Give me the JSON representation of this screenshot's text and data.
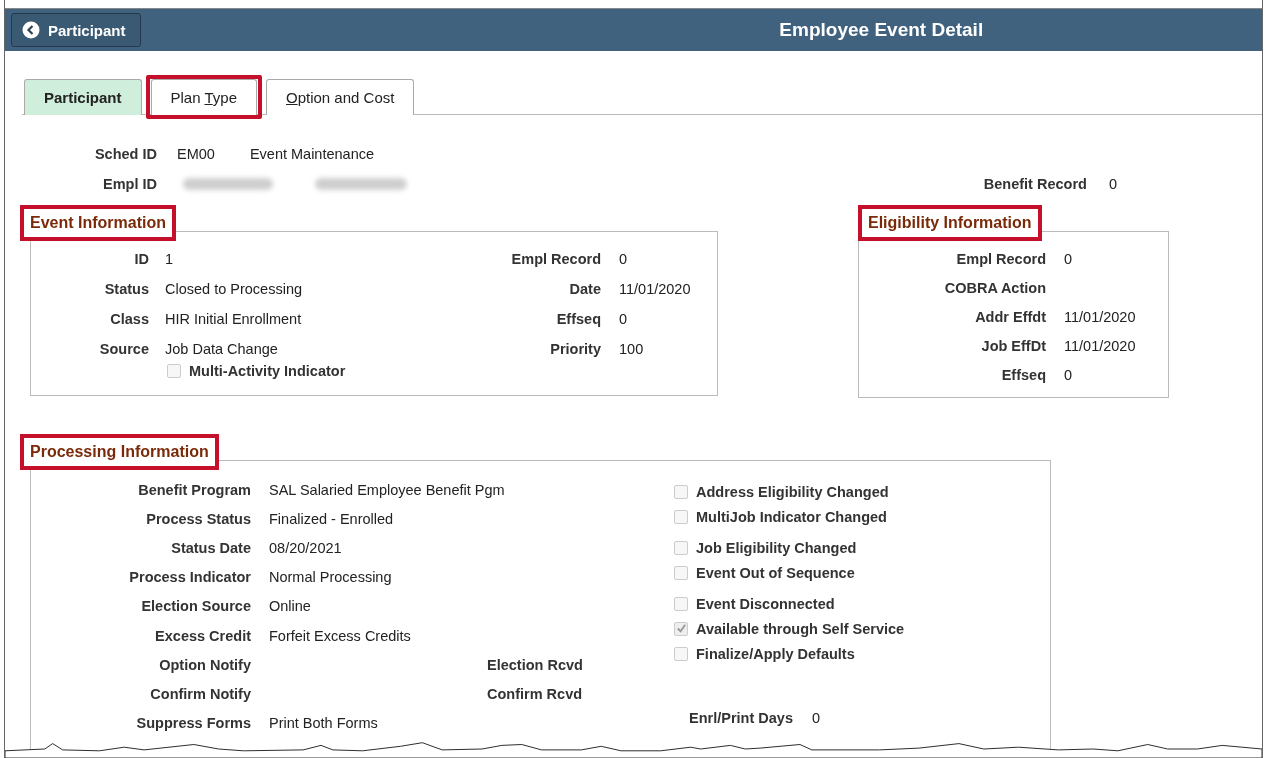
{
  "header": {
    "back_button": {
      "label": "Participant"
    },
    "title": "Employee Event Detail"
  },
  "tabs": [
    {
      "label_parts": [
        {
          "text": "Participant",
          "underlined": false
        }
      ],
      "selected": true,
      "highlighted": false
    },
    {
      "label_parts": [
        {
          "text": "Plan ",
          "underlined": false
        },
        {
          "text": "T",
          "underlined": true
        },
        {
          "text": "ype",
          "underlined": false
        }
      ],
      "selected": false,
      "highlighted": true
    },
    {
      "label_parts": [
        {
          "text": "O",
          "underlined": true
        },
        {
          "text": "ption and Cost",
          "underlined": false
        }
      ],
      "selected": false,
      "highlighted": false
    }
  ],
  "summary": {
    "sched_id": {
      "label": "Sched ID",
      "code": "EM00",
      "description": "Event Maintenance"
    },
    "empl_id": {
      "label": "Empl ID",
      "redacted": true
    },
    "benefit_record": {
      "label": "Benefit Record",
      "value": "0"
    }
  },
  "event_information": {
    "title": "Event Information",
    "highlighted": true,
    "left_fields": [
      {
        "label": "ID",
        "value": "1"
      },
      {
        "label": "Status",
        "value": "Closed to Processing"
      },
      {
        "label": "Class",
        "value": "HIR  Initial Enrollment"
      },
      {
        "label": "Source",
        "value": "Job Data Change"
      }
    ],
    "right_fields": [
      {
        "label": "Empl Record",
        "value": "0"
      },
      {
        "label": "Date",
        "value": "11/01/2020"
      },
      {
        "label": "Effseq",
        "value": "0"
      },
      {
        "label": "Priority",
        "value": "100"
      }
    ],
    "checkbox": {
      "label": "Multi-Activity Indicator",
      "checked": false
    }
  },
  "eligibility_information": {
    "title": "Eligibility Information",
    "highlighted": true,
    "fields": [
      {
        "label": "Empl Record",
        "value": "0"
      },
      {
        "label": "COBRA Action"
      },
      {
        "label": "Addr Effdt",
        "value": "11/01/2020"
      },
      {
        "label": "Job EffDt",
        "value": "11/01/2020"
      },
      {
        "label": "Effseq",
        "value": "0"
      }
    ]
  },
  "processing_information": {
    "title": "Processing Information",
    "highlighted": true,
    "fields": [
      {
        "label": "Benefit Program",
        "value": "SAL  Salaried Employee Benefit Pgm"
      },
      {
        "label": "Process Status",
        "value": "Finalized - Enrolled"
      },
      {
        "label": "Status Date",
        "value": "08/20/2021"
      },
      {
        "label": "Process Indicator",
        "value": "Normal Processing"
      },
      {
        "label": "Election Source",
        "value": "Online"
      },
      {
        "label": "Excess Credit",
        "value": "Forfeit Excess Credits"
      },
      {
        "label": "Option Notify",
        "second_label": "Election Rcvd"
      },
      {
        "label": "Confirm Notify",
        "second_label": "Confirm Rcvd"
      },
      {
        "label": "Suppress Forms",
        "value": "Print Both Forms"
      }
    ],
    "checkboxes": [
      {
        "label": "Address Eligibility Changed",
        "checked": false
      },
      {
        "label": "MultiJob Indicator Changed",
        "checked": false
      },
      {
        "label": "Job Eligibility Changed",
        "checked": false
      },
      {
        "label": "Event Out of Sequence",
        "checked": false
      },
      {
        "label": "Event Disconnected",
        "checked": false
      },
      {
        "label": "Available through Self Service",
        "checked": true
      },
      {
        "label": "Finalize/Apply Defaults",
        "checked": false
      }
    ],
    "enrl_print_days": {
      "label": "Enrl/Print Days",
      "value": "0"
    }
  }
}
